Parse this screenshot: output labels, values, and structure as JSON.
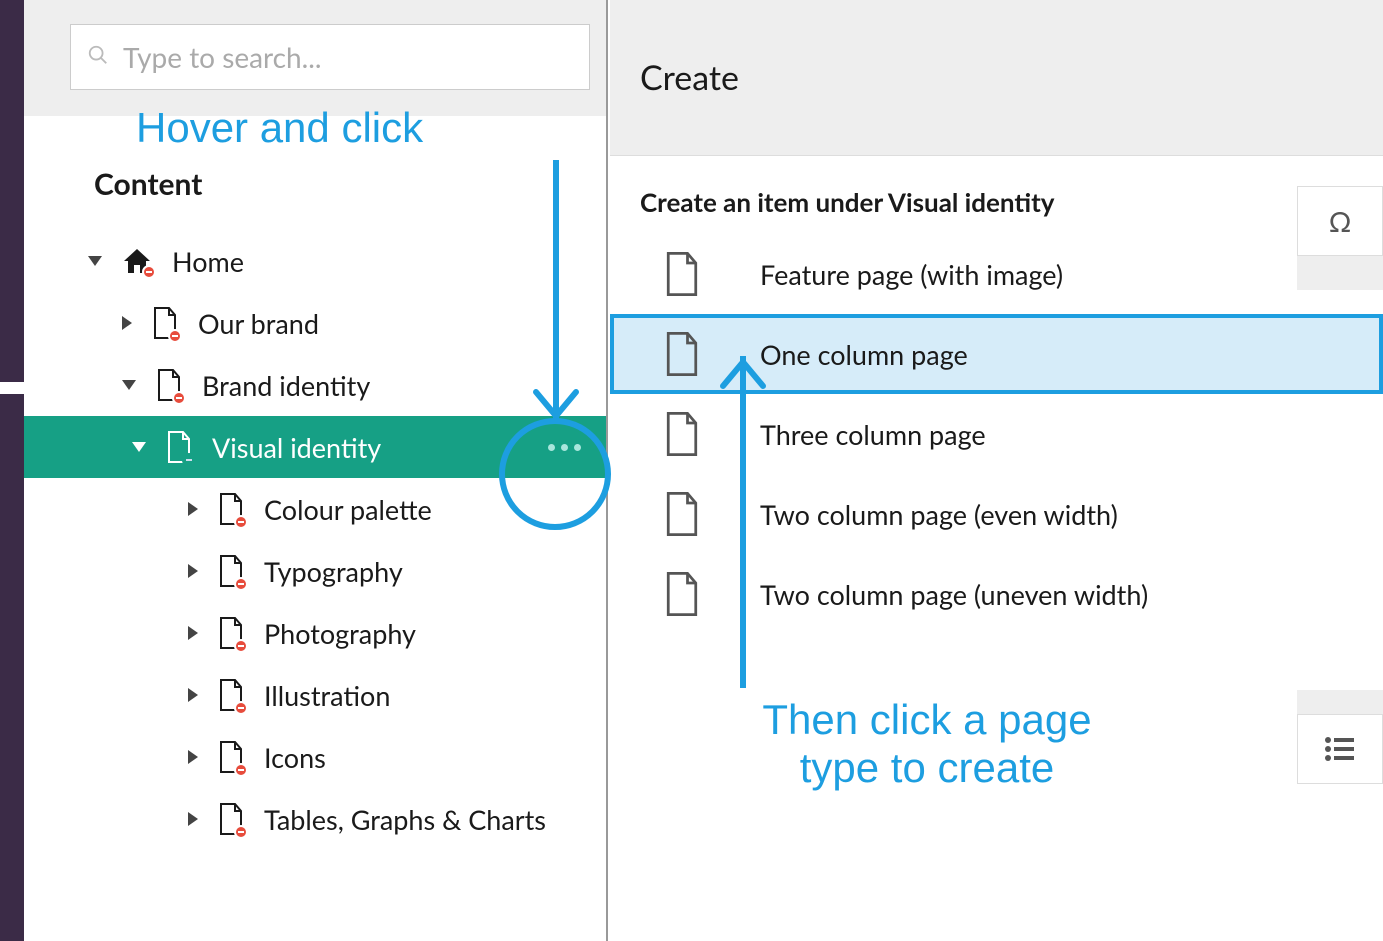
{
  "search": {
    "placeholder": "Type to search..."
  },
  "sidebar": {
    "heading": "Content",
    "items": {
      "home": "Home",
      "our_brand": "Our brand",
      "brand_identity": "Brand identity",
      "visual_identity": "Visual identity",
      "colour_palette": "Colour palette",
      "typography": "Typography",
      "photography": "Photography",
      "illustration": "Illustration",
      "icons": "Icons",
      "tables": "Tables, Graphs & Charts"
    }
  },
  "create": {
    "title": "Create",
    "subtitle": "Create an item under Visual identity",
    "types": [
      "Feature page (with image)",
      "One column page",
      "Three column page",
      "Two column page (even width)",
      "Two column page (uneven width)"
    ]
  },
  "far_right": {
    "omega": "Ω",
    "list": ""
  },
  "annot": {
    "line1": "Hover and click",
    "line2a": "Then click a page",
    "line2b": "type to create"
  }
}
